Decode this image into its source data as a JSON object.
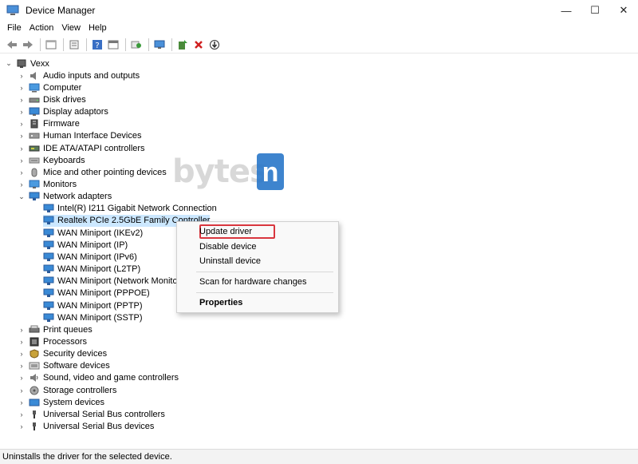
{
  "window": {
    "title": "Device Manager",
    "minimize": "—",
    "maximize": "☐",
    "close": "✕"
  },
  "menu": [
    "File",
    "Action",
    "View",
    "Help"
  ],
  "tree": {
    "root": "Vexx",
    "categories": [
      {
        "label": "Audio inputs and outputs",
        "icon": "speaker-icon"
      },
      {
        "label": "Computer",
        "icon": "computer-icon"
      },
      {
        "label": "Disk drives",
        "icon": "disk-icon"
      },
      {
        "label": "Display adaptors",
        "icon": "display-icon"
      },
      {
        "label": "Firmware",
        "icon": "firmware-icon"
      },
      {
        "label": "Human Interface Devices",
        "icon": "hid-icon"
      },
      {
        "label": "IDE ATA/ATAPI controllers",
        "icon": "ide-icon"
      },
      {
        "label": "Keyboards",
        "icon": "keyboard-icon"
      },
      {
        "label": "Mice and other pointing devices",
        "icon": "mouse-icon"
      },
      {
        "label": "Monitors",
        "icon": "monitor-icon"
      },
      {
        "label": "Network adapters",
        "icon": "network-icon",
        "expanded": true
      }
    ],
    "network_children": [
      "Intel(R) I211 Gigabit Network Connection",
      "Realtek PCIe 2.5GbE Family Controller",
      "WAN Miniport (IKEv2)",
      "WAN Miniport (IP)",
      "WAN Miniport (IPv6)",
      "WAN Miniport (L2TP)",
      "WAN Miniport (Network Monitor)",
      "WAN Miniport (PPPOE)",
      "WAN Miniport (PPTP)",
      "WAN Miniport (SSTP)"
    ],
    "categories_after": [
      {
        "label": "Print queues",
        "icon": "printer-icon"
      },
      {
        "label": "Processors",
        "icon": "processor-icon"
      },
      {
        "label": "Security devices",
        "icon": "security-icon"
      },
      {
        "label": "Software devices",
        "icon": "software-icon"
      },
      {
        "label": "Sound, video and game controllers",
        "icon": "sound-icon"
      },
      {
        "label": "Storage controllers",
        "icon": "storage-icon"
      },
      {
        "label": "System devices",
        "icon": "system-icon"
      },
      {
        "label": "Universal Serial Bus controllers",
        "icon": "usb-icon"
      },
      {
        "label": "Universal Serial Bus devices",
        "icon": "usb-icon"
      }
    ]
  },
  "context_menu": {
    "update": "Update driver",
    "disable": "Disable device",
    "uninstall": "Uninstall device",
    "scan": "Scan for hardware changes",
    "properties": "Properties"
  },
  "status": "Uninstalls the driver for the selected device.",
  "watermark": {
    "text": "bytes",
    "badge": "n"
  },
  "colors": {
    "highlight": "#d9363e",
    "selection": "#cce8ff",
    "adapter": "#2a8bd6"
  }
}
